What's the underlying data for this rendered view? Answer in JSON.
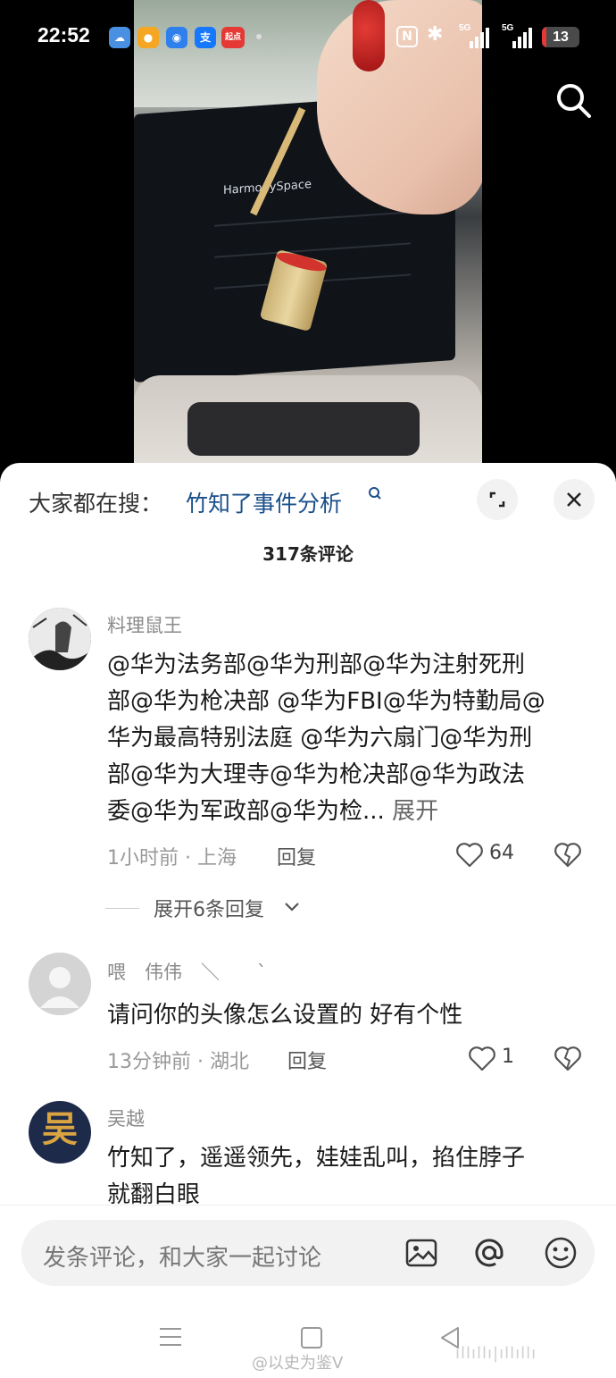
{
  "status_bar": {
    "time": "22:52",
    "apps": [
      {
        "icon": "weather-icon",
        "color": "#4a90e2",
        "glyph": "☁"
      },
      {
        "icon": "weibo-icon",
        "color": "#f5a623",
        "glyph": "●"
      },
      {
        "icon": "browser-icon",
        "color": "#2f80ed",
        "glyph": "◉"
      },
      {
        "icon": "alipay-icon",
        "color": "#1677ff",
        "glyph": "支"
      },
      {
        "icon": "qidian-icon",
        "color": "#e53935",
        "glyph": "起点"
      }
    ],
    "signal_labels": [
      "5G",
      "5G"
    ],
    "battery": "13",
    "battery_level": 0.13
  },
  "sheet": {
    "search_prefix": "大家都在搜：",
    "search_link": "竹知了事件分析",
    "comment_count": "317条评论"
  },
  "comments": [
    {
      "name": "料理鼠王",
      "lines": [
        "@华为法务部@华为刑部@华为注射死刑",
        "部@华为枪决部 @华为FBI@华为特勤局@",
        "华为最高特别法庭 @华为六扇门@华为刑",
        "部@华为大理寺@华为枪决部@华为政法",
        "委@华为军政部@华为检..."
      ],
      "more": "展开",
      "meta": "1小时前 · 上海",
      "reply": "回复",
      "likes": "64",
      "expand": "展开6条回复"
    },
    {
      "name": "喂　伟伟　＼　　`",
      "lines": [
        "请问你的头像怎么设置的 好有个性"
      ],
      "meta": "13分钟前 · 湖北",
      "reply": "回复",
      "likes": "1"
    },
    {
      "name": "吴越",
      "avatar_char": "吴",
      "lines": [
        "竹知了，遥遥领先，娃娃乱叫，掐住脖子",
        "就翻白眼"
      ]
    }
  ],
  "input": {
    "placeholder": "发条评论，和大家一起讨论"
  },
  "watermark": "@以史为鉴V",
  "watermark_right": "ıllıllı|ıllıllı",
  "video_screen_text": "HarmonySpace"
}
